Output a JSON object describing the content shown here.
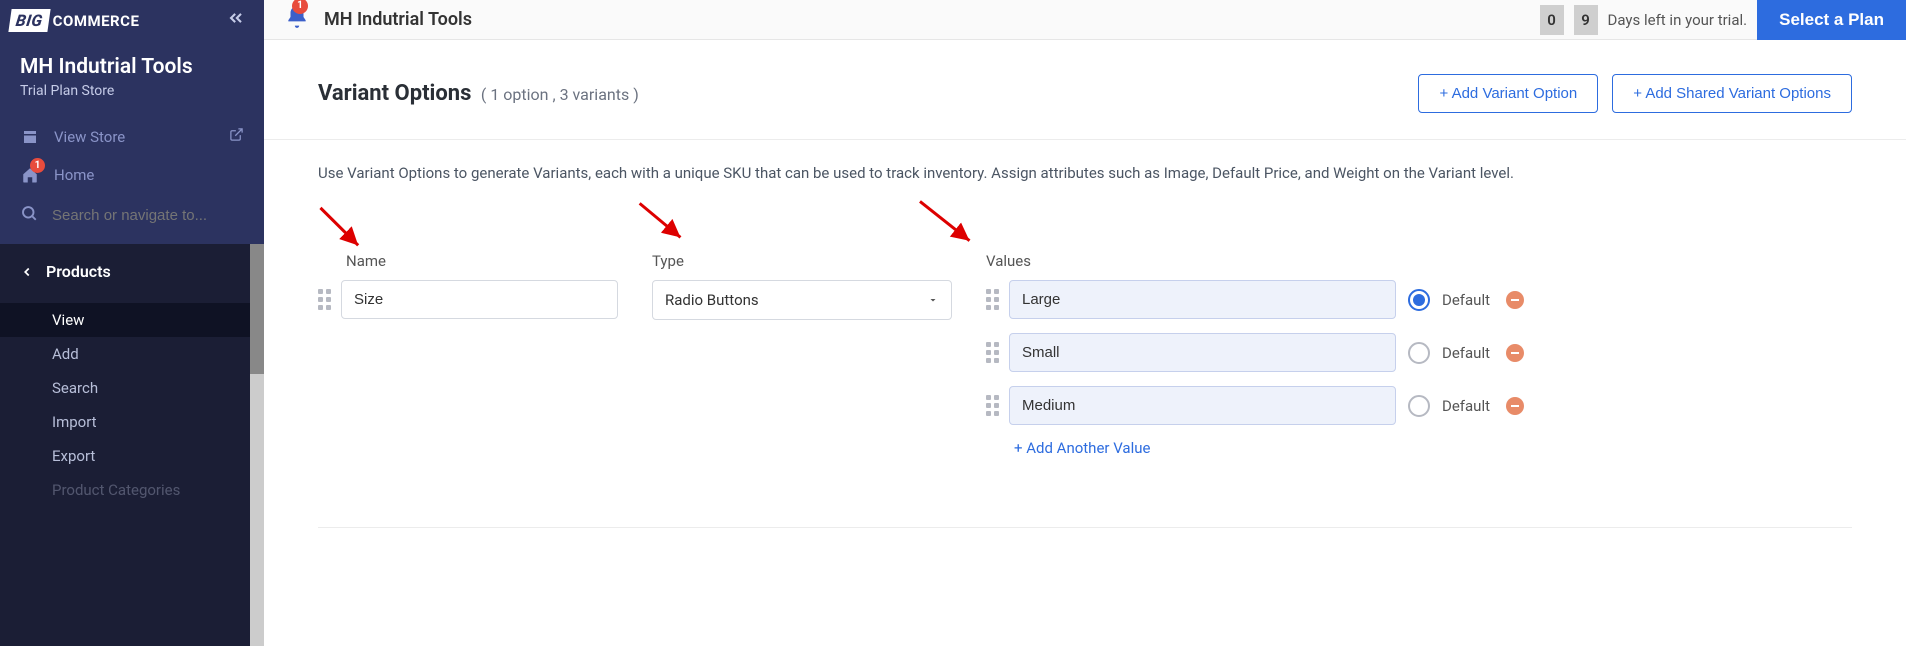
{
  "brand": {
    "big": "BIG",
    "commerce": "COMMERCE"
  },
  "store": {
    "name": "MH Indutrial Tools",
    "plan": "Trial Plan Store"
  },
  "nav": {
    "view_store": "View Store",
    "home": "Home",
    "home_badge": "1",
    "search_placeholder": "Search or navigate to..."
  },
  "products": {
    "header": "Products",
    "items": [
      "View",
      "Add",
      "Search",
      "Import",
      "Export",
      "Product Categories"
    ]
  },
  "topbar": {
    "bell_badge": "1",
    "title": "MH Indutrial Tools",
    "trial_digits": [
      "0",
      "9"
    ],
    "trial_text": "Days left in your trial.",
    "plan_btn": "Select a Plan"
  },
  "section": {
    "title": "Variant Options",
    "subtitle": "( 1 option , 3 variants )",
    "btn_add_variant": "+ Add Variant Option",
    "btn_add_shared": "+ Add Shared Variant Options",
    "desc": "Use Variant Options to generate Variants, each with a unique SKU that can be used to track inventory. Assign attributes such as Image, Default Price, and Weight on the Variant level."
  },
  "labels": {
    "name": "Name",
    "type": "Type",
    "values": "Values",
    "default": "Default",
    "add_another": "+ Add Another Value"
  },
  "option": {
    "name": "Size",
    "type": "Radio Buttons",
    "values": [
      {
        "label": "Large",
        "is_default": true
      },
      {
        "label": "Small",
        "is_default": false
      },
      {
        "label": "Medium",
        "is_default": false
      }
    ]
  }
}
